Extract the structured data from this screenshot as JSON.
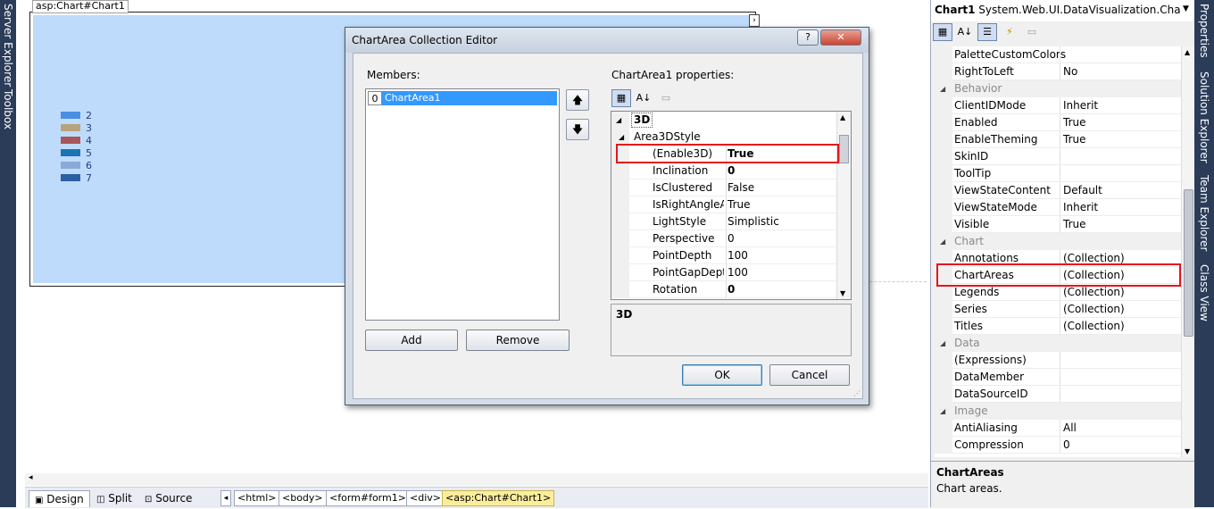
{
  "left_strip": {
    "server_explorer": "Server Explorer",
    "toolbox": "Toolbox"
  },
  "design": {
    "chart_tag": "asp:Chart#Chart1",
    "legend": [
      {
        "label": "2",
        "color": "#4a8fe0"
      },
      {
        "label": "3",
        "color": "#b7a37c"
      },
      {
        "label": "4",
        "color": "#a8555b"
      },
      {
        "label": "5",
        "color": "#1a76b3"
      },
      {
        "label": "6",
        "color": "#8aa9d6"
      },
      {
        "label": "7",
        "color": "#2a5fa3"
      }
    ]
  },
  "bottom_bar": {
    "tabs": [
      {
        "label": "Design",
        "active": true
      },
      {
        "label": "Split"
      },
      {
        "label": "Source"
      }
    ],
    "crumbs": [
      "<html>",
      "<body>",
      "<form#form1>",
      "<div>",
      "<asp:Chart#Chart1>"
    ]
  },
  "dialog": {
    "title": "ChartArea Collection Editor",
    "help_btn": "?",
    "close_btn": "✕",
    "members_label": "Members:",
    "members": [
      {
        "index": "0",
        "name": "ChartArea1"
      }
    ],
    "add_btn": "Add",
    "remove_btn": "Remove",
    "properties_label": "ChartArea1 properties:",
    "category": "3D",
    "group": "Area3DStyle",
    "rows": [
      {
        "name": "(Enable3D)",
        "value": "True",
        "bold": true
      },
      {
        "name": "Inclination",
        "value": "0",
        "bold": true
      },
      {
        "name": "IsClustered",
        "value": "False",
        "bold": false
      },
      {
        "name": "IsRightAngleAxes",
        "value": "True",
        "bold": false
      },
      {
        "name": "LightStyle",
        "value": "Simplistic",
        "bold": false
      },
      {
        "name": "Perspective",
        "value": "0",
        "bold": false
      },
      {
        "name": "PointDepth",
        "value": "100",
        "bold": false
      },
      {
        "name": "PointGapDepth",
        "value": "100",
        "bold": false
      },
      {
        "name": "Rotation",
        "value": "0",
        "bold": true
      }
    ],
    "description": "3D",
    "ok_btn": "OK",
    "cancel_btn": "Cancel"
  },
  "properties": {
    "object": "Chart1",
    "object_type": "System.Web.UI.DataVisualization.Charting.C",
    "items": [
      {
        "type": "row",
        "name": "PaletteCustomColors",
        "value": ""
      },
      {
        "type": "row",
        "name": "RightToLeft",
        "value": "No"
      },
      {
        "type": "cat",
        "name": "Behavior"
      },
      {
        "type": "row",
        "name": "ClientIDMode",
        "value": "Inherit"
      },
      {
        "type": "row",
        "name": "Enabled",
        "value": "True"
      },
      {
        "type": "row",
        "name": "EnableTheming",
        "value": "True"
      },
      {
        "type": "row",
        "name": "SkinID",
        "value": ""
      },
      {
        "type": "row",
        "name": "ToolTip",
        "value": ""
      },
      {
        "type": "row",
        "name": "ViewStateContent",
        "value": "Default"
      },
      {
        "type": "row",
        "name": "ViewStateMode",
        "value": "Inherit"
      },
      {
        "type": "row",
        "name": "Visible",
        "value": "True"
      },
      {
        "type": "cat",
        "name": "Chart"
      },
      {
        "type": "row",
        "name": "Annotations",
        "value": "(Collection)"
      },
      {
        "type": "row",
        "name": "ChartAreas",
        "value": "(Collection)"
      },
      {
        "type": "row",
        "name": "Legends",
        "value": "(Collection)"
      },
      {
        "type": "row",
        "name": "Series",
        "value": "(Collection)"
      },
      {
        "type": "row",
        "name": "Titles",
        "value": "(Collection)"
      },
      {
        "type": "cat",
        "name": "Data"
      },
      {
        "type": "row",
        "name": "(Expressions)",
        "value": ""
      },
      {
        "type": "row",
        "name": "DataMember",
        "value": ""
      },
      {
        "type": "row",
        "name": "DataSourceID",
        "value": ""
      },
      {
        "type": "cat",
        "name": "Image"
      },
      {
        "type": "row",
        "name": "AntiAliasing",
        "value": "All"
      },
      {
        "type": "row",
        "name": "Compression",
        "value": "0"
      }
    ],
    "desc_title": "ChartAreas",
    "desc_text": "Chart areas."
  },
  "right_strip": {
    "properties": "Properties",
    "solution_explorer": "Solution Explorer",
    "team_explorer": "Team Explorer",
    "class_view": "Class View"
  }
}
